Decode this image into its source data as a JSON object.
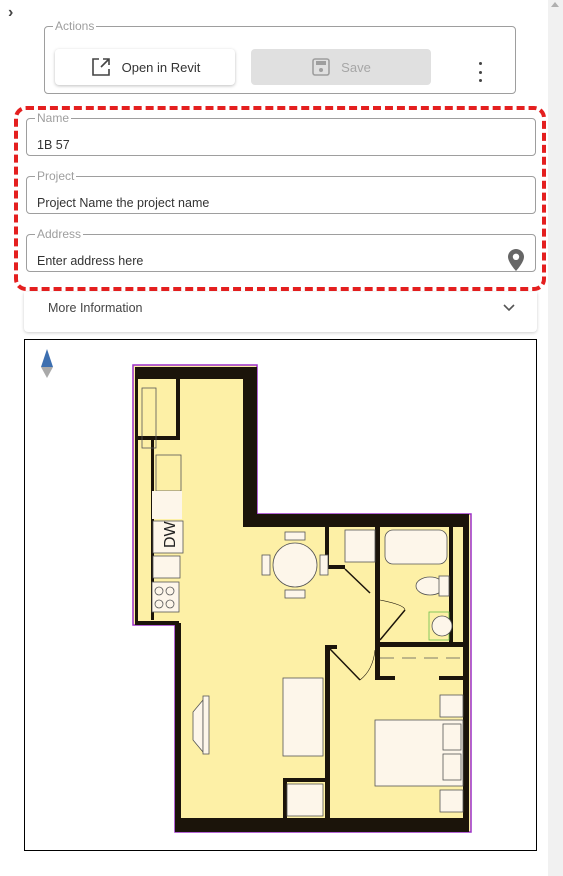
{
  "panel": {
    "collapse_icon": "chevron-right-icon"
  },
  "actions": {
    "legend": "Actions",
    "open_in_revit_label": "Open in Revit",
    "open_in_revit_icon": "open-external-icon",
    "save_label": "Save",
    "save_icon": "floppy-disk-icon",
    "save_enabled": false,
    "more_icon": "more-vertical-icon"
  },
  "fields": {
    "name": {
      "label": "Name",
      "value": "1B 57"
    },
    "project": {
      "label": "Project",
      "value": "Project Name the project name"
    },
    "address": {
      "label": "Address",
      "value": "Enter address here",
      "icon": "map-pin-icon"
    }
  },
  "more_info": {
    "label": "More Information",
    "icon": "chevron-down-icon",
    "expanded": false
  },
  "floor_plan": {
    "north_arrow": "north-arrow-icon",
    "appliance_label": "DW",
    "colors": {
      "floor": "#fdf0a6",
      "wall": "#1b140a",
      "outline": "#9b30c8",
      "fixture": "#fdf6ea"
    }
  },
  "highlight_color": "#e41f1f"
}
